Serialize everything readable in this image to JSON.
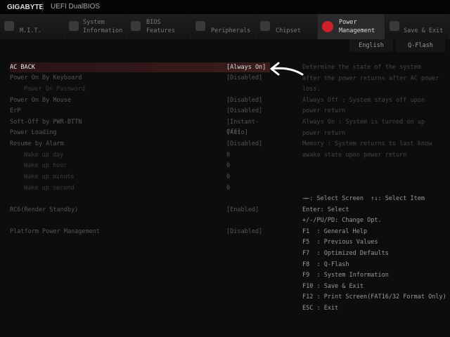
{
  "header": {
    "brand": "GIGABYTE",
    "product": "UEFI DualBIOS"
  },
  "tabs": [
    {
      "label1": "",
      "label2": "M.I.T.",
      "icon": "mit-icon"
    },
    {
      "label1": "System",
      "label2": "Information",
      "icon": "gear-icon"
    },
    {
      "label1": "BIOS",
      "label2": "Features",
      "icon": "bios-icon"
    },
    {
      "label1": "",
      "label2": "Peripherals",
      "icon": "peripherals-icon"
    },
    {
      "label1": "",
      "label2": "Chipset",
      "icon": "chipset-icon"
    },
    {
      "label1": "Power",
      "label2": "Management",
      "icon": "power-icon",
      "active": true
    },
    {
      "label1": "",
      "label2": "Save & Exit",
      "icon": "exit-icon"
    }
  ],
  "toolbar": {
    "english": "English",
    "qflash": "Q-Flash"
  },
  "settings": [
    {
      "label": "AC BACK",
      "value": "[Always On]"
    },
    {
      "label": "Power On By Keyboard",
      "value": "[Disabled]"
    },
    {
      "label": "Power On Password",
      "value": ""
    },
    {
      "label": "Power On By Mouse",
      "value": "[Disabled]"
    },
    {
      "label": "ErP",
      "value": "[Disabled]"
    },
    {
      "label": "Soft-Off by PWR-BTTN",
      "value": "[Instant-Off]"
    },
    {
      "label": "Power Loading",
      "value": "[Auto]"
    },
    {
      "label": "Resume by Alarm",
      "value": "[Disabled]"
    },
    {
      "label": "Wake up day",
      "value": "0"
    },
    {
      "label": "Wake up hour",
      "value": "0"
    },
    {
      "label": "Wake up minute",
      "value": "0"
    },
    {
      "label": "Wake up second",
      "value": "0"
    },
    {
      "label": "RC6(Render Standby)",
      "value": "[Enabled]"
    },
    {
      "label": "Platform Power Management",
      "value": "[Disabled]"
    }
  ],
  "help": [
    "Determine the state of  the system",
    "after the power returns after AC power",
    "loss.",
    "Always Off : System stays off upon",
    "power return",
    "Always On : System is turned on up",
    "power return",
    "Memory : System returns to last know",
    "awake state upon power return"
  ],
  "keys": [
    "→←: Select Screen  ↑↓: Select Item",
    "Enter: Select",
    "+/-/PU/PD: Change Opt.",
    "F1  : General Help",
    "F5  : Previous Values",
    "F7  : Optimized Defaults",
    "F8  : Q-Flash",
    "F9  : System Information",
    "F10 : Save & Exit",
    "F12 : Print Screen(FAT16/32 Format Only)",
    "ESC : Exit"
  ],
  "colors": {
    "accent": "#d0202a",
    "selected_row": "#3a1c1c"
  }
}
